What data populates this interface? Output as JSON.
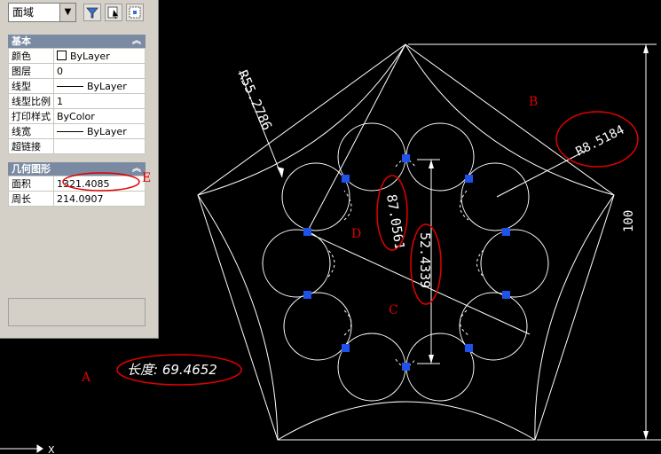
{
  "palette": {
    "select": {
      "value": "面域"
    },
    "toolbar_icons": [
      "quick-select-icon",
      "select-objects-icon",
      "pickadd-icon"
    ],
    "basic": {
      "title": "基本",
      "rows": [
        {
          "label": "颜色",
          "value": "ByLayer",
          "decor": "swatch"
        },
        {
          "label": "图层",
          "value": "0"
        },
        {
          "label": "线型",
          "value": "ByLayer",
          "decor": "line"
        },
        {
          "label": "线型比例",
          "value": "1"
        },
        {
          "label": "打印样式",
          "value": "ByColor"
        },
        {
          "label": "线宽",
          "value": "ByLayer",
          "decor": "line"
        },
        {
          "label": "超链接",
          "value": ""
        }
      ]
    },
    "geometry": {
      "title": "几何图形",
      "rows": [
        {
          "label": "面积",
          "value": "1321.4085"
        },
        {
          "label": "周长",
          "value": "214.0907"
        }
      ]
    }
  },
  "drawing": {
    "dimensions": {
      "r_outer": "R55.2786",
      "r_small": "R8.5184",
      "diag": "87.0561",
      "vert": "52.4339",
      "height": "100"
    },
    "length_label": "长度: 69.4652",
    "markers": {
      "A": "A",
      "B": "B",
      "C": "C",
      "D": "D",
      "E": "E"
    },
    "ucs_label": "X",
    "colors": {
      "lines": "#ffffff",
      "grips": "#1e52e8",
      "annotation": "#ff0000"
    }
  }
}
